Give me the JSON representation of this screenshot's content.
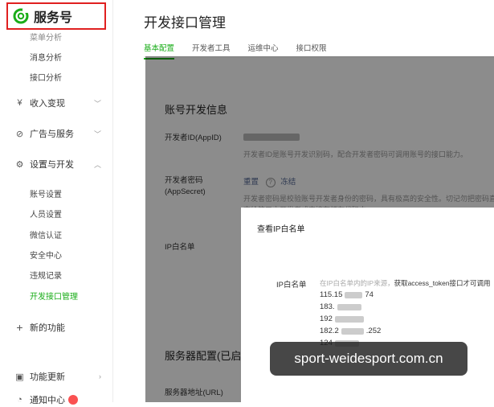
{
  "brand": {
    "name": "服务号"
  },
  "sidebar": {
    "top_items": [
      "菜单分析",
      "消息分析",
      "接口分析"
    ],
    "groups": {
      "revenue": "收入变现",
      "ads": "广告与服务",
      "settings": "设置与开发",
      "new_features": "新的功能",
      "updates": "功能更新",
      "notice": "通知中心"
    },
    "settings_items": [
      "账号设置",
      "人员设置",
      "微信认证",
      "安全中心",
      "违规记录",
      "开发接口管理"
    ]
  },
  "main": {
    "title": "开发接口管理",
    "tabs": [
      "基本配置",
      "开发者工具",
      "运维中心",
      "接口权限"
    ],
    "active_tab": "基本配置"
  },
  "panel": {
    "section_title": "账号开发信息",
    "appid_label": "开发者ID(AppID)",
    "appid_desc": "开发者ID是账号开发识别码，配合开发者密码可调用账号的接口能力。",
    "secret_label": "开发者密码(AppSecret)",
    "secret_actions": [
      "重置",
      "冻结"
    ],
    "secret_desc1": "开发者密码是校验账号开发者身份的密码，具有极高的安全性。切记勿把密码直",
    "secret_desc2": "交给第三方开发者或直接存储在代码中。",
    "ip_label": "IP白名单",
    "server_section_title": "服务器配置(已启用)",
    "server_addr_label": "服务器地址(URL)"
  },
  "modal": {
    "title": "查看IP白名单",
    "label": "IP白名单",
    "desc_prefix": "在IP白名单内的IP来源，",
    "desc_highlight": "获取access_token接口才可调用",
    "ips": [
      {
        "start": "115.15",
        "end": "74"
      },
      {
        "start": "183.",
        "end": ""
      },
      {
        "start": "192",
        "end": ""
      },
      {
        "start": "182.2",
        "end": ".252"
      },
      {
        "start": "124",
        "end": ""
      }
    ]
  },
  "watermark": {
    "text": "sport-weidesport.com.cn"
  },
  "colors": {
    "accent": "#1aad19",
    "highlight_border": "#e02020",
    "badge": "#fa5151"
  }
}
